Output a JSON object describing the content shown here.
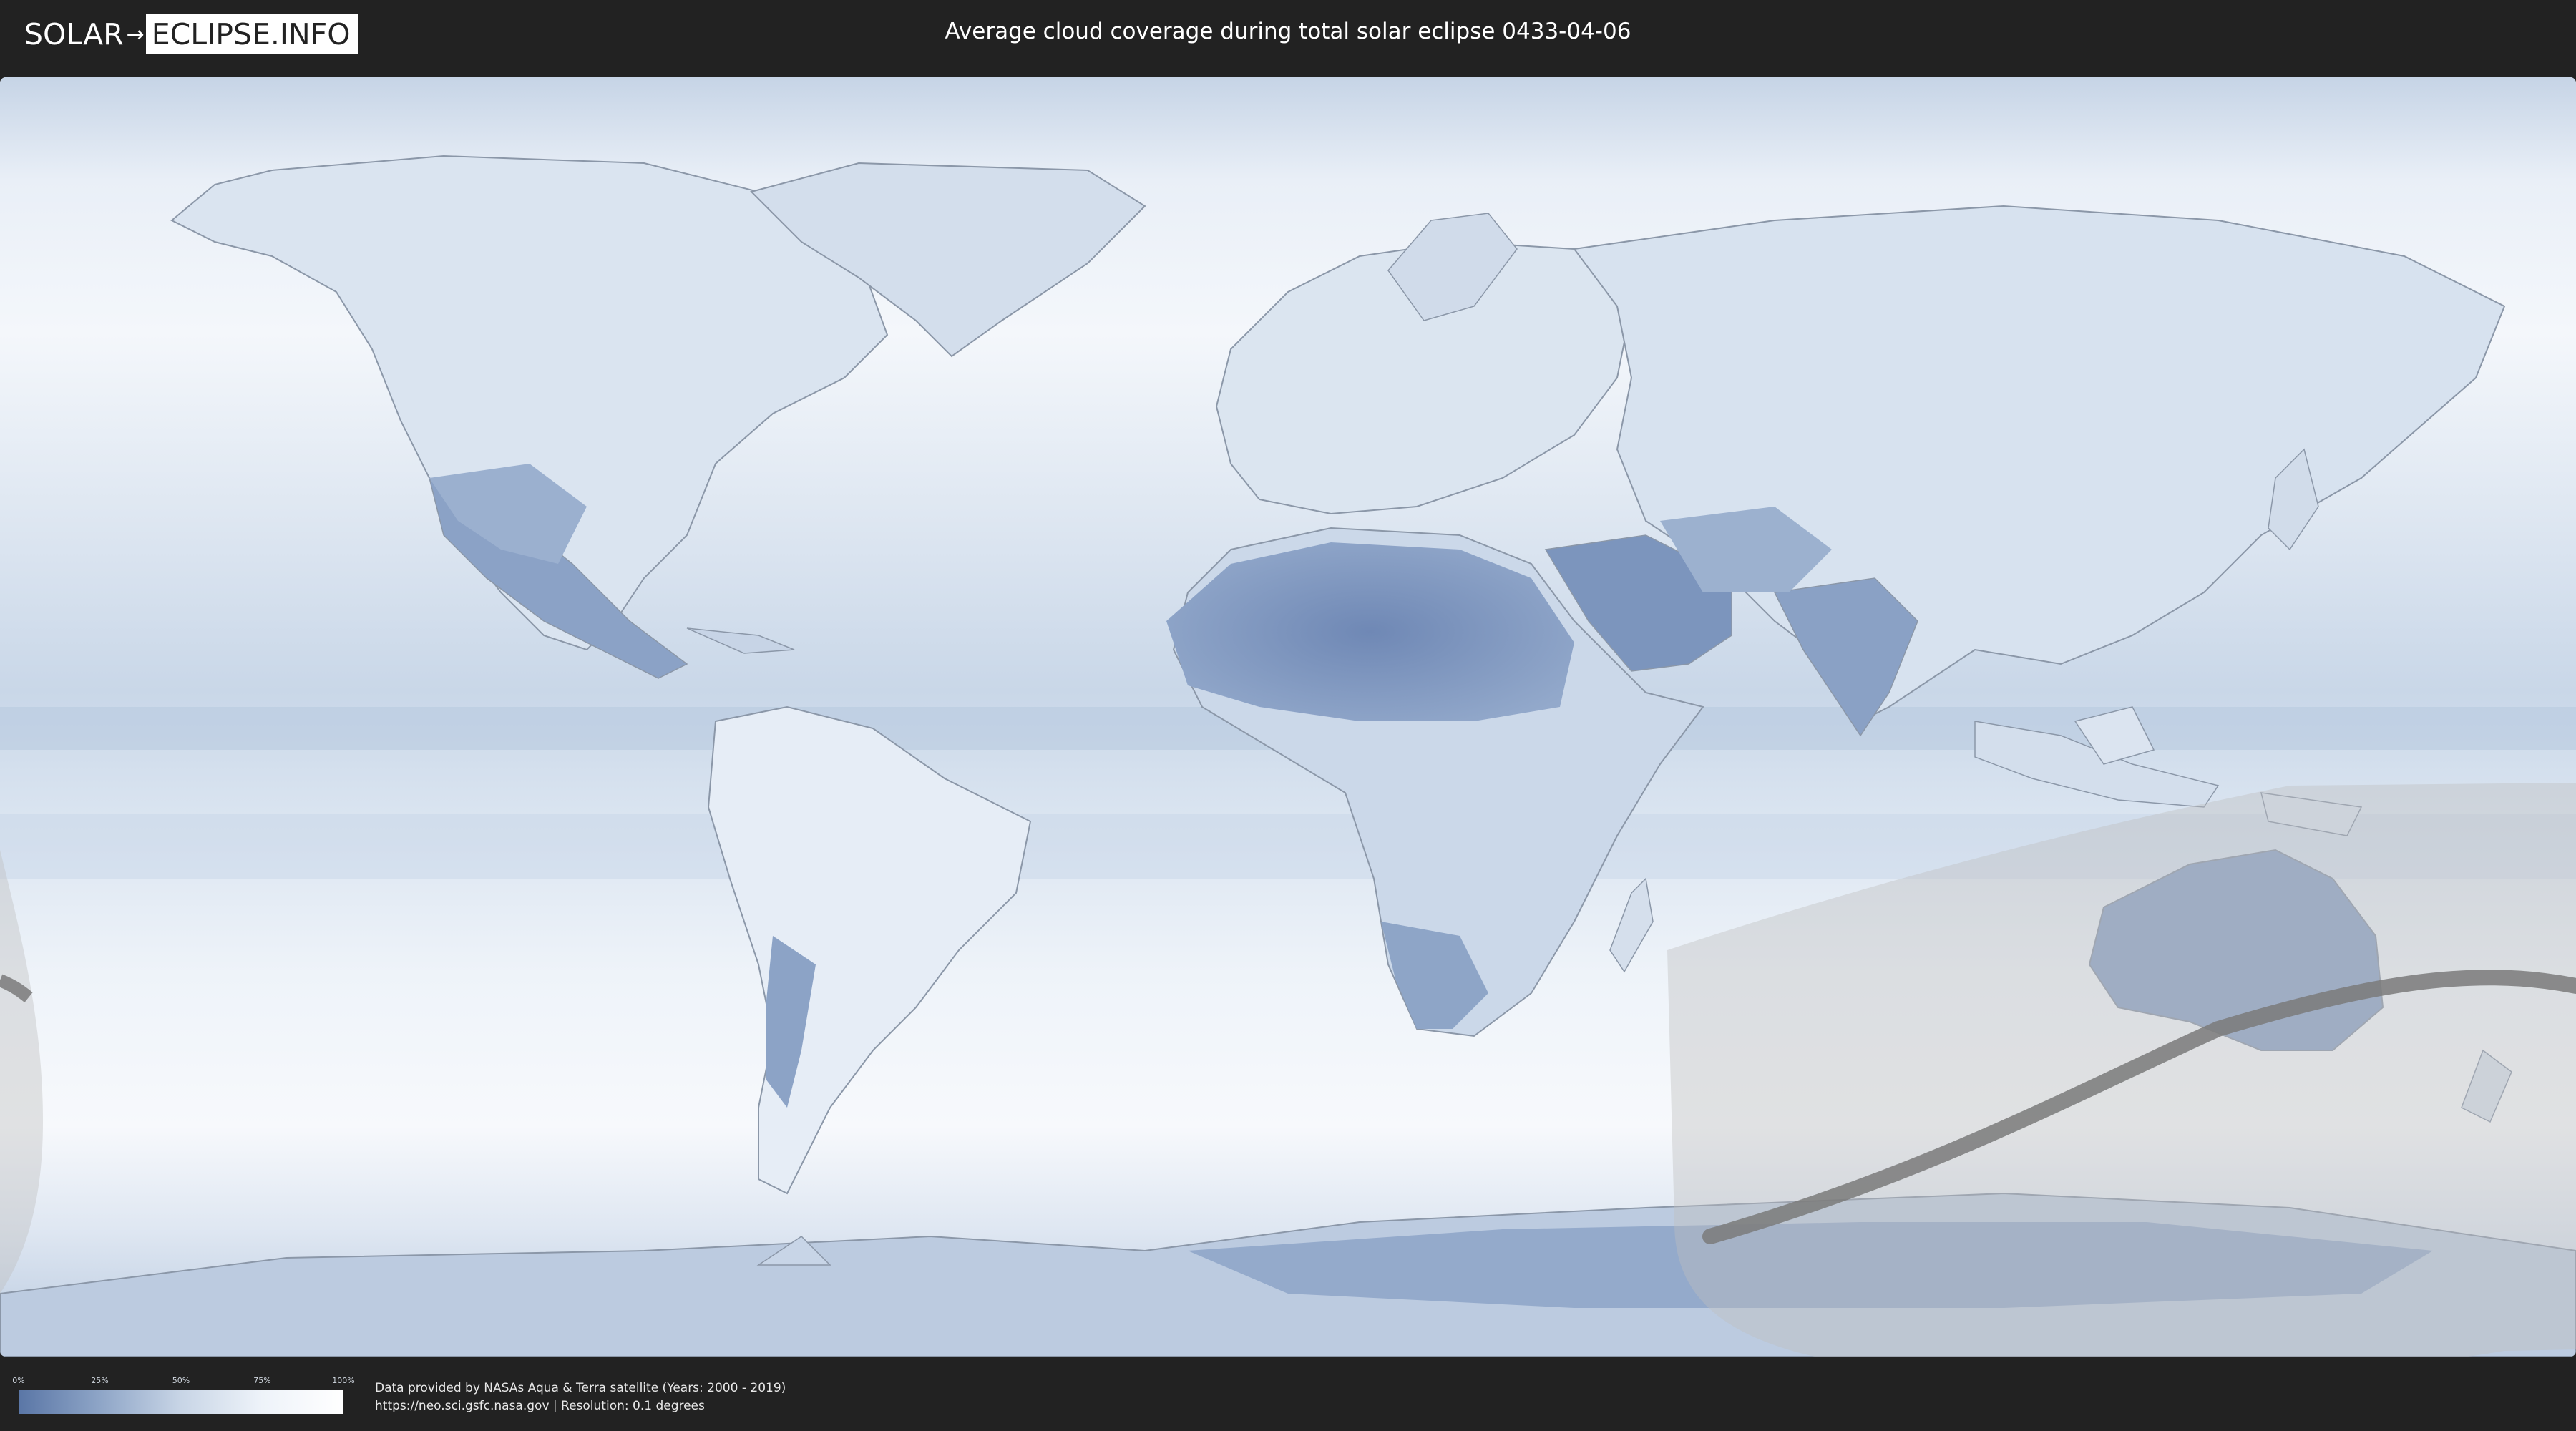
{
  "header": {
    "logo_solar": "SOLAR",
    "logo_eclipse": "ECLIPSE.INFO",
    "title": "Average cloud coverage during total solar eclipse 0433-04-06"
  },
  "legend": {
    "ticks": [
      "0%",
      "25%",
      "50%",
      "75%",
      "100%"
    ],
    "tick_fractions": [
      0,
      0.25,
      0.5,
      0.75,
      1
    ],
    "colors": [
      "#5a76a6",
      "#8ea5c7",
      "#c8d5e6",
      "#eef3f9",
      "#ffffff"
    ]
  },
  "credits": {
    "line1": "Data provided by NASAs Aqua & Terra satellite (Years: 2000 - 2019)",
    "line2": "https://neo.sci.gsfc.nasa.gov | Resolution: 0.1 degrees"
  },
  "map": {
    "projection": "equirectangular",
    "ocean_color": "#e6eef6",
    "land_clear_color": "#6d87b4",
    "cloudy_color": "#f5f8fc",
    "eclipse_shadow_color": "#bdbdbd",
    "eclipse_path_color": "#7a7a7a",
    "icons": [
      "solar-logo-mark",
      "world-map",
      "eclipse-visibility-overlay",
      "totality-path"
    ]
  }
}
